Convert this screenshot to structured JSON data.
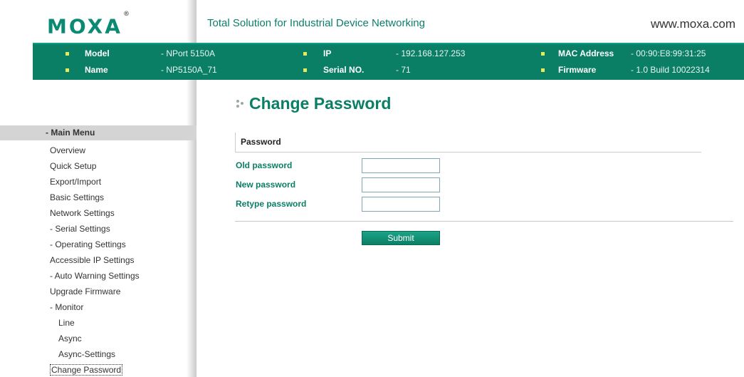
{
  "header": {
    "logo_text": "MOXA",
    "logo_mark": "®",
    "tagline": "Total Solution for Industrial Device Networking",
    "site_url": "www.moxa.com"
  },
  "device_info": {
    "model_label": "Model",
    "model_value": "- NPort 5150A",
    "name_label": "Name",
    "name_value": "- NP5150A_71",
    "ip_label": "IP",
    "ip_value": "- 192.168.127.253",
    "serial_label": "Serial NO.",
    "serial_value": "- 71",
    "mac_label": "MAC Address",
    "mac_value": "- 00:90:E8:99:31:25",
    "firmware_label": "Firmware",
    "firmware_value": "- 1.0 Build 10022314"
  },
  "sidebar": {
    "menu_title": "- Main Menu",
    "items": [
      {
        "label": "Overview"
      },
      {
        "label": "Quick Setup"
      },
      {
        "label": "Export/Import"
      },
      {
        "label": "Basic Settings"
      },
      {
        "label": "Network Settings"
      },
      {
        "label": "- Serial Settings"
      },
      {
        "label": "- Operating Settings"
      },
      {
        "label": "Accessible IP Settings"
      },
      {
        "label": "- Auto Warning Settings"
      },
      {
        "label": "Upgrade Firmware"
      },
      {
        "label": "- Monitor"
      },
      {
        "label": "Line"
      },
      {
        "label": "Async"
      },
      {
        "label": "Async-Settings"
      },
      {
        "label": "Change Password"
      }
    ]
  },
  "main": {
    "page_title": "Change Password",
    "section_title": "Password",
    "old_password_label": "Old password",
    "old_password_value": "",
    "new_password_label": "New password",
    "new_password_value": "",
    "retype_password_label": "Retype password",
    "retype_password_value": "",
    "submit_label": "Submit"
  },
  "colors": {
    "brand_green": "#0b7f66",
    "bullet_yellow": "#e8e85b",
    "menu_header_gray": "#d4d4d4"
  }
}
